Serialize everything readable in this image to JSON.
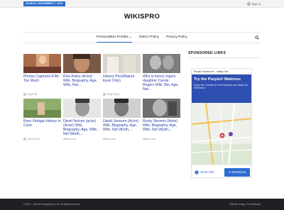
{
  "topbar": {
    "date": "SUNDAY, NOVEMBER 7, 2021",
    "signin": "Sign in"
  },
  "site": {
    "logo": "WIKISPRO"
  },
  "nav": {
    "items": [
      {
        "label": "Personalities Profiles ⌄"
      },
      {
        "label": "DMCA Policy"
      },
      {
        "label": "Privacy Policy"
      }
    ]
  },
  "cards": [
    {
      "title": "Photos Captured A Bit Too Much",
      "source": "Sport Hill"
    },
    {
      "title": "Rick Aviles (Actor) Wiki, Biography, Age, Wife, Net...",
      "source": ""
    },
    {
      "title": "History Pics(Mature Eyes Only)",
      "source": "Daily Funny"
    },
    {
      "title": "Who is kenny rogers daughter Carole Rogers Wiki, Bio, Age, Net...",
      "source": ""
    },
    {
      "title": "Rare Vintage History In Color",
      "source": "Glory Trend"
    },
    {
      "title": "David Nelson (actor) (Actor) Wiki, Biography, Age, Wife, Net Worth,...",
      "source": "wikispro.com"
    },
    {
      "title": "David Janssen (Actor) Wiki, Biography, Age, Wife, Net Worth,...",
      "source": "wikispro.com"
    },
    {
      "title": "Rusty Stevens (Actor) Wiki, Biography, Age, Wife, Net Worth,...",
      "source": "wikispro.com"
    }
  ],
  "sidebar": {
    "heading": "SPONSORED LINKS",
    "ad": {
      "top_label": "Purple Showroom - Valley Fair",
      "headline": "Try the Purple® Mattress",
      "body": "Enjoy the Comfort of Your Mattress and Wake Up Refreshed.",
      "store_info": "Store info",
      "directions": "Directions"
    }
  },
  "footer": {
    "left": "© 2021 – Wiki and Biography for All. All Rights Reserved.",
    "right": "Website Design: ThemeStacks"
  },
  "colors": {
    "accent": "#2b6ccf",
    "footer": "#1f2026",
    "ad_banner": "#2f4fb0",
    "link": "#2b3ea6"
  }
}
